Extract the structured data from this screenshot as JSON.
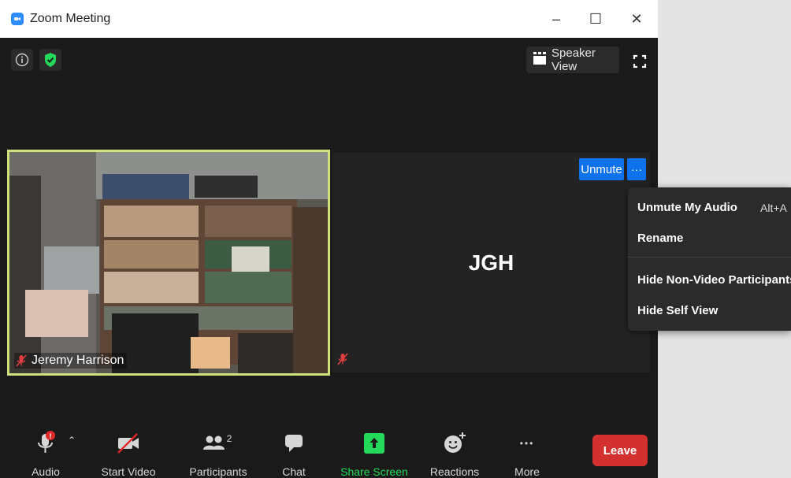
{
  "window": {
    "title": "Zoom Meeting",
    "minimize": "–",
    "maximize": "☐",
    "close": "✕"
  },
  "top": {
    "speaker_view_label": "Speaker View"
  },
  "participants_tiles": [
    {
      "name": "Jeremy Harrison"
    },
    {
      "initials": "JGH",
      "unmute_label": "Unmute",
      "more_label": "···"
    }
  ],
  "context_menu": {
    "items": [
      {
        "label": "Unmute My Audio",
        "shortcut": "Alt+A"
      },
      {
        "label": "Rename"
      },
      {
        "label": "Hide Non-Video Participants"
      },
      {
        "label": "Hide Self View"
      }
    ]
  },
  "toolbar": {
    "audio_label": "Audio",
    "audio_alert": "!",
    "start_video_label": "Start Video",
    "participants_label": "Participants",
    "participants_count": "2",
    "chat_label": "Chat",
    "share_screen_label": "Share Screen",
    "reactions_label": "Reactions",
    "more_label": "More",
    "more_dots": "•••",
    "leave_label": "Leave",
    "share_color": "#23d959",
    "leave_color": "#d3312f"
  }
}
